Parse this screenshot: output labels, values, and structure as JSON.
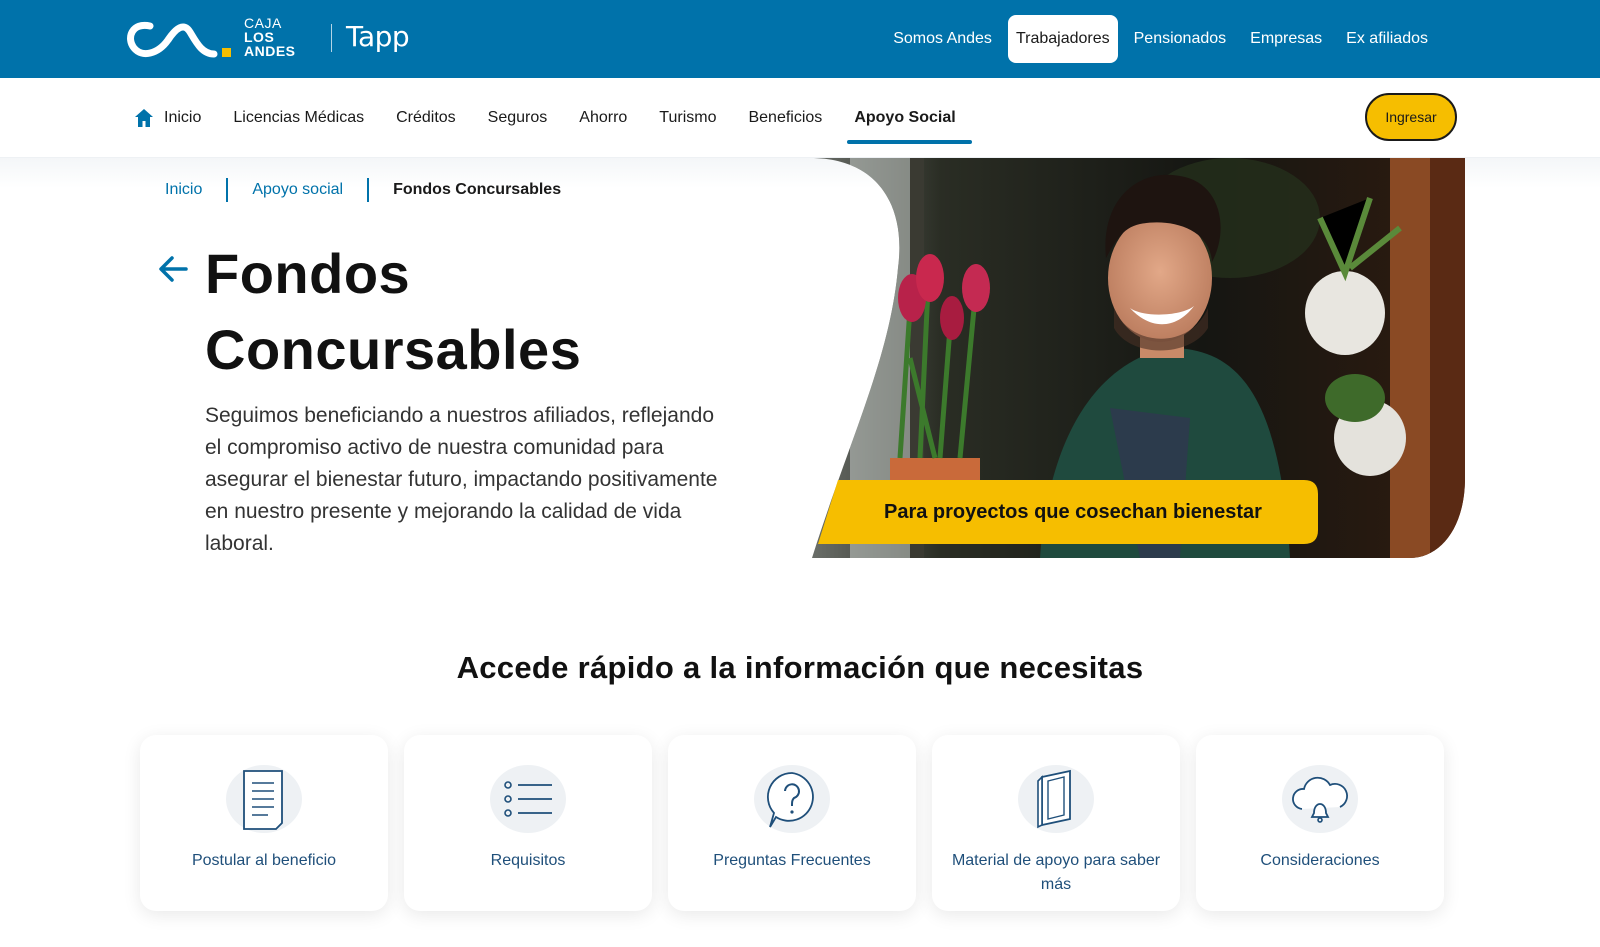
{
  "brand": {
    "caja_line1": "CAJA",
    "caja_line2": "LOS",
    "caja_line3": "ANDES",
    "tapp": "Tapp",
    "primary_color": "#0072aa",
    "accent_color": "#f6be00"
  },
  "topnav": {
    "items": [
      {
        "label": "Somos Andes",
        "active": false
      },
      {
        "label": "Trabajadores",
        "active": true
      },
      {
        "label": "Pensionados",
        "active": false
      },
      {
        "label": "Empresas",
        "active": false
      },
      {
        "label": "Ex afiliados",
        "active": false
      }
    ]
  },
  "mainnav": {
    "items": [
      {
        "label": "Inicio",
        "icon": "home-icon"
      },
      {
        "label": "Licencias Médicas"
      },
      {
        "label": "Créditos"
      },
      {
        "label": "Seguros"
      },
      {
        "label": "Ahorro"
      },
      {
        "label": "Turismo"
      },
      {
        "label": "Beneficios"
      },
      {
        "label": "Apoyo Social",
        "active": true
      }
    ],
    "login_label": "Ingresar"
  },
  "breadcrumb": {
    "items": [
      "Inicio",
      "Apoyo social",
      "Fondos Concursables"
    ]
  },
  "hero": {
    "title_line1": "Fondos",
    "title_line2": "Concursables",
    "description": "Seguimos beneficiando a nuestros afiliados, reflejando el compromiso activo de nuestra comunidad para asegurar el bienestar futuro, impactando positivamente en nuestro presente y mejorando la calidad de vida laboral.",
    "tag": "Para proyectos que cosechan bienestar"
  },
  "quick_access": {
    "title": "Accede rápido a la información que necesitas",
    "cards": [
      {
        "label": "Postular al beneficio",
        "icon": "document-icon"
      },
      {
        "label": "Requisitos",
        "icon": "list-icon"
      },
      {
        "label": "Preguntas Frecuentes",
        "icon": "question-icon"
      },
      {
        "label": "Material de apoyo para saber más",
        "icon": "book-icon"
      },
      {
        "label": "Consideraciones",
        "icon": "cloud-bell-icon"
      }
    ]
  }
}
